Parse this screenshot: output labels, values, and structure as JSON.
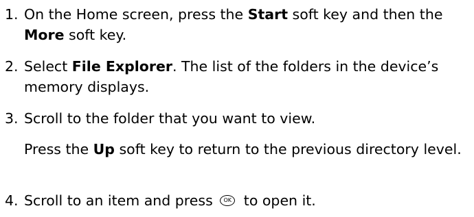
{
  "steps": [
    {
      "number": "1.",
      "pre": "On the Home screen, press the ",
      "key1": "Start",
      "mid": " soft key and then the ",
      "key2": "More",
      "post": " soft key."
    },
    {
      "number": "2.",
      "pre": "Select ",
      "key1": "File Explorer",
      "post": ". The list of the folders in the device’s memory displays."
    },
    {
      "number": "3.",
      "text": "Scroll to the folder that you want to view."
    },
    {
      "number": "4.",
      "pre": "Scroll to an item and press ",
      "icon_label": "OK",
      "icon_name": "ok-button-icon",
      "post": " to open it."
    }
  ],
  "note": {
    "pre": "Press the ",
    "key": "Up",
    "post": " soft key to return to the previous directory level."
  }
}
